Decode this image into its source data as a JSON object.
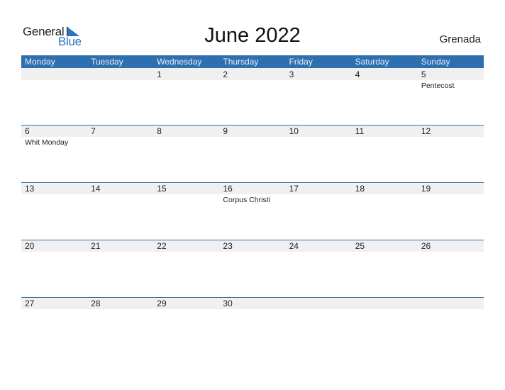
{
  "logo": {
    "text_general": "General",
    "text_blue": "Blue",
    "icon": "triangle-flag-icon",
    "accent_color": "#2b74c2"
  },
  "title": "June 2022",
  "country": "Grenada",
  "header_color": "#2e6fb0",
  "weekdays": [
    "Monday",
    "Tuesday",
    "Wednesday",
    "Thursday",
    "Friday",
    "Saturday",
    "Sunday"
  ],
  "weeks": [
    {
      "days": [
        {
          "num": "",
          "holiday": ""
        },
        {
          "num": "",
          "holiday": ""
        },
        {
          "num": "1",
          "holiday": ""
        },
        {
          "num": "2",
          "holiday": ""
        },
        {
          "num": "3",
          "holiday": ""
        },
        {
          "num": "4",
          "holiday": ""
        },
        {
          "num": "5",
          "holiday": "Pentecost"
        }
      ]
    },
    {
      "days": [
        {
          "num": "6",
          "holiday": "Whit Monday"
        },
        {
          "num": "7",
          "holiday": ""
        },
        {
          "num": "8",
          "holiday": ""
        },
        {
          "num": "9",
          "holiday": ""
        },
        {
          "num": "10",
          "holiday": ""
        },
        {
          "num": "11",
          "holiday": ""
        },
        {
          "num": "12",
          "holiday": ""
        }
      ]
    },
    {
      "days": [
        {
          "num": "13",
          "holiday": ""
        },
        {
          "num": "14",
          "holiday": ""
        },
        {
          "num": "15",
          "holiday": ""
        },
        {
          "num": "16",
          "holiday": "Corpus Christi"
        },
        {
          "num": "17",
          "holiday": ""
        },
        {
          "num": "18",
          "holiday": ""
        },
        {
          "num": "19",
          "holiday": ""
        }
      ]
    },
    {
      "days": [
        {
          "num": "20",
          "holiday": ""
        },
        {
          "num": "21",
          "holiday": ""
        },
        {
          "num": "22",
          "holiday": ""
        },
        {
          "num": "23",
          "holiday": ""
        },
        {
          "num": "24",
          "holiday": ""
        },
        {
          "num": "25",
          "holiday": ""
        },
        {
          "num": "26",
          "holiday": ""
        }
      ]
    },
    {
      "days": [
        {
          "num": "27",
          "holiday": ""
        },
        {
          "num": "28",
          "holiday": ""
        },
        {
          "num": "29",
          "holiday": ""
        },
        {
          "num": "30",
          "holiday": ""
        },
        {
          "num": "",
          "holiday": ""
        },
        {
          "num": "",
          "holiday": ""
        },
        {
          "num": "",
          "holiday": ""
        }
      ]
    }
  ]
}
